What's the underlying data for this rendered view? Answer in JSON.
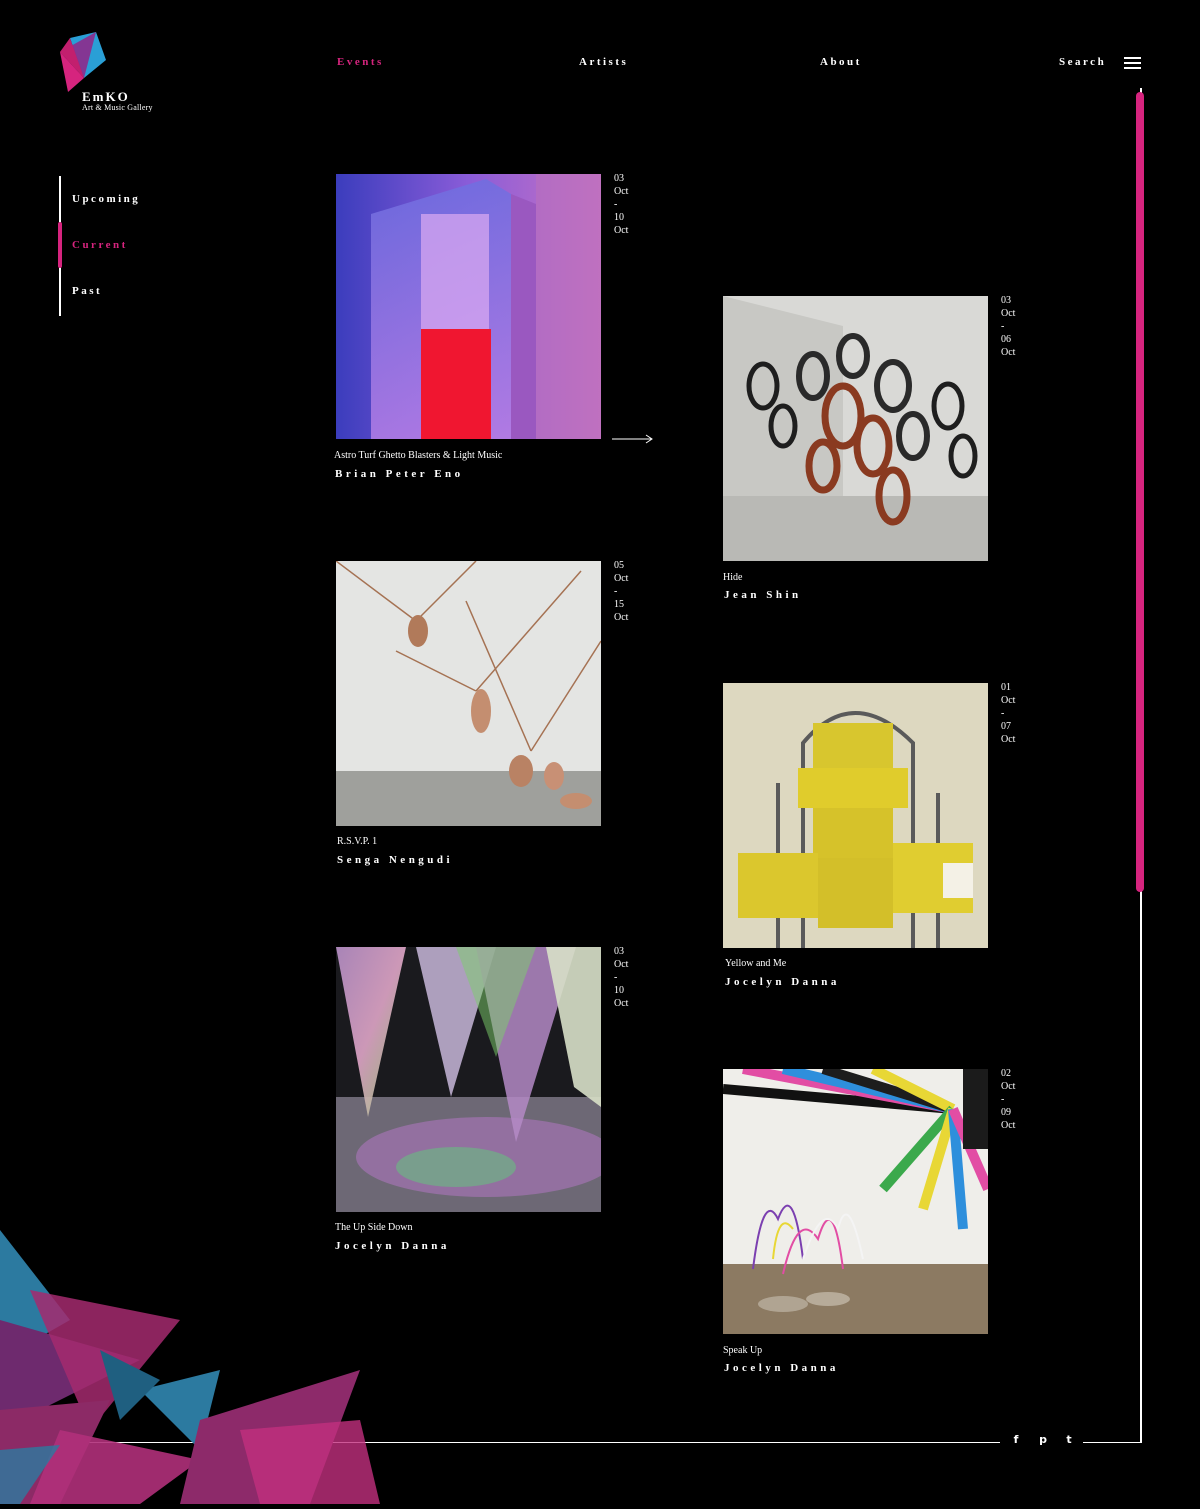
{
  "brand": {
    "name": "EmKO",
    "subtitle": "Art & Music Gallery",
    "colors": {
      "accent": "#d6247e",
      "secondary": "#2a9fd6"
    }
  },
  "nav": {
    "events": "Events",
    "artists": "Artists",
    "about": "About",
    "search": "Search",
    "menu_icon": "hamburger-icon"
  },
  "sidebar": {
    "items": [
      "Upcoming",
      "Current",
      "Past"
    ],
    "active": "Current"
  },
  "events": [
    {
      "title": "Astro Turf Ghetto Blasters & Light Music",
      "artist": "Brian Peter Eno",
      "date": "03\nOct\n-\n10\nOct"
    },
    {
      "title": "Hide",
      "artist": "Jean Shin",
      "date": "03\nOct\n-\n06\nOct"
    },
    {
      "title": "R.S.V.P. 1",
      "artist": "Senga Nengudi",
      "date": "05\nOct\n-\n15\nOct"
    },
    {
      "title": "Yellow and Me",
      "artist": "Jocelyn Danna",
      "date": "01\nOct\n-\n07\nOct"
    },
    {
      "title": "The Up Side Down",
      "artist": "Jocelyn Danna",
      "date": "03\nOct\n-\n10\nOct"
    },
    {
      "title": "Speak Up",
      "artist": "Jocelyn Danna",
      "date": "02\nOct\n-\n09\nOct"
    }
  ],
  "social": {
    "facebook": "f",
    "pinterest": "p",
    "twitter": "t",
    "icons": [
      "facebook-icon",
      "pinterest-icon",
      "twitter-icon"
    ]
  },
  "scroll": {
    "position_fraction": 0.0,
    "visible_fraction": 0.6
  }
}
